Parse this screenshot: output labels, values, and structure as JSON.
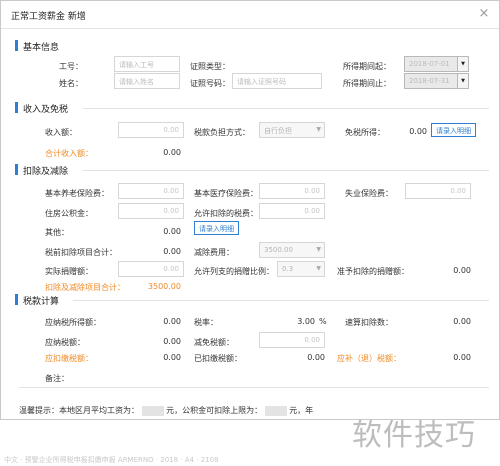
{
  "dialog": {
    "title": "正常工资薪金 新增",
    "close": "×"
  },
  "basic": {
    "title": "基本信息",
    "id_label": "工号：",
    "id_placeholder": "请输入工号",
    "cert_type_label": "证照类型：",
    "period_start_label": "所得期间起：",
    "period_start": "2018-07-01",
    "name_label": "姓名：",
    "name_placeholder": "请输入姓名",
    "cert_no_label": "证照号码：",
    "cert_no_placeholder": "请输入证照号码",
    "period_end_label": "所得期间止：",
    "period_end": "2018-07-31"
  },
  "income": {
    "title": "收入及免税",
    "income_label": "收入额：",
    "income_value": "0.00",
    "tax_mode_label": "税款负担方式：",
    "tax_mode_value": "自行负担",
    "exempt_label": "免税所得：",
    "exempt_value": "0.00",
    "exempt_button": "请录入明细",
    "total_label": "合计收入额：",
    "total_value": "0.00"
  },
  "deduction": {
    "title": "扣除及减除",
    "pension_label": "基本养老保险费：",
    "pension_value": "0.00",
    "medical_label": "基本医疗保险费：",
    "medical_value": "0.00",
    "unemp_label": "失业保险费：",
    "unemp_value": "0.00",
    "housing_label": "住房公积金：",
    "housing_value": "0.00",
    "allowed_tax_label": "允许扣除的税费：",
    "allowed_tax_value": "0.00",
    "other_label": "其他：",
    "other_value": "0.00",
    "other_button": "请录入明细",
    "pretax_total_label": "税前扣除项目合计：",
    "pretax_total_value": "0.00",
    "reduction_label": "减除费用：",
    "reduction_value": "3500.00",
    "donation_label": "实际捐赠额：",
    "donation_value": "0.00",
    "donation_ratio_label": "允许列支的捐赠比例：",
    "donation_ratio_value": "0.3",
    "donation_deduct_label": "准予扣除的捐赠额：",
    "donation_deduct_value": "0.00",
    "grand_total_label": "扣除及减除项目合计：",
    "grand_total_value": "3500.00"
  },
  "tax": {
    "title": "税款计算",
    "taxable_label": "应纳税所得额：",
    "taxable_value": "0.00",
    "rate_label": "税率：",
    "rate_value": "3.00",
    "rate_unit": "%",
    "quick_label": "速算扣除数：",
    "quick_value": "0.00",
    "payable_label": "应纳税额：",
    "payable_value": "0.00",
    "relief_label": "减免税额：",
    "relief_value": "0.00",
    "should_label": "应扣缴税额：",
    "should_value": "0.00",
    "paid_label": "已扣缴税额：",
    "paid_value": "0.00",
    "refund_label": "应补（退）税额：",
    "refund_value": "0.00",
    "remark_label": "备注："
  },
  "tip": {
    "prefix": "温馨提示：本地区月平均工资为：",
    "mid": "元，公积金可扣除上限为：",
    "suffix": "元，年"
  },
  "watermark": "软件技巧",
  "footer": "中文 · 预警企业所得税申报扣缴申报 ARMERNO · 2018 · A4 · 2108"
}
